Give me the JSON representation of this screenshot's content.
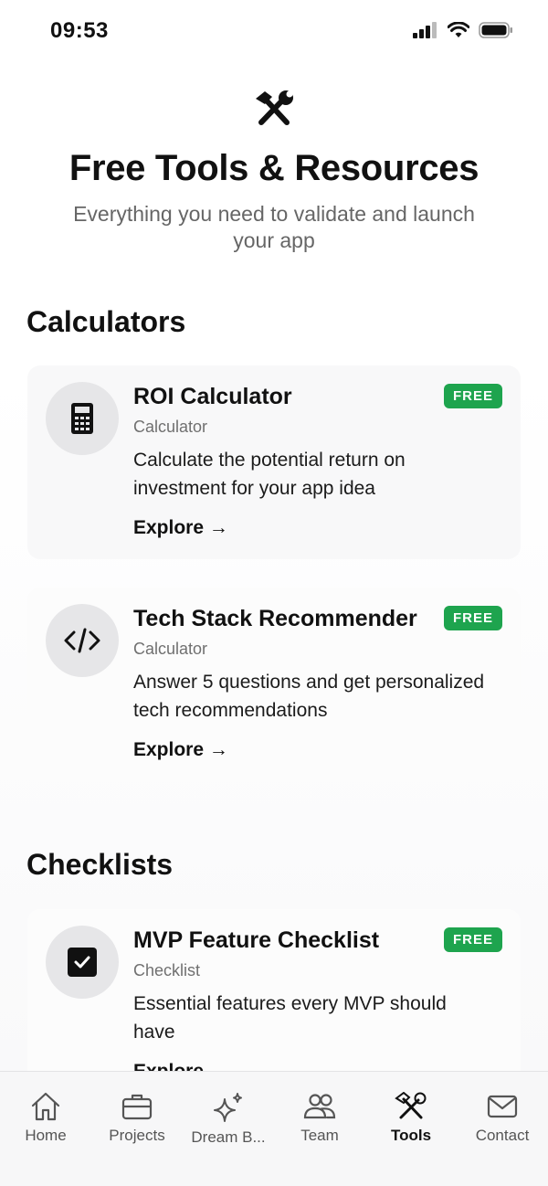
{
  "status_bar": {
    "time": "09:53"
  },
  "hero": {
    "icon": "tools-icon",
    "title": "Free Tools & Resources",
    "subtitle": "Everything you need to validate and launch your app"
  },
  "sections": {
    "calculators": {
      "title": "Calculators"
    },
    "checklists": {
      "title": "Checklists"
    }
  },
  "cards": [
    {
      "icon": "calculator-icon",
      "title": "ROI Calculator",
      "badge": "FREE",
      "type": "Calculator",
      "description": "Calculate the potential return on investment for your app idea",
      "link": "Explore →"
    },
    {
      "icon": "code-icon",
      "title": "Tech Stack Recommender",
      "badge": "FREE",
      "type": "Calculator",
      "description": "Answer 5 questions and get personalized tech recommendations",
      "link": "Explore →"
    },
    {
      "icon": "checkbox-icon",
      "title": "MVP Feature Checklist",
      "badge": "FREE",
      "type": "Checklist",
      "description": "Essential features every MVP should have",
      "link": "Explore →"
    }
  ],
  "tab_bar": {
    "active": "Tools",
    "tabs": [
      {
        "label": "Home",
        "icon": "home-icon"
      },
      {
        "label": "Projects",
        "icon": "briefcase-icon"
      },
      {
        "label": "Dream B...",
        "icon": "sparkles-icon"
      },
      {
        "label": "Team",
        "icon": "people-icon"
      },
      {
        "label": "Tools",
        "icon": "tools-icon"
      },
      {
        "label": "Contact",
        "icon": "mail-icon"
      }
    ]
  },
  "colors": {
    "badge": "#1ea44e",
    "text": "#111111",
    "muted": "#707070",
    "icon_circle": "#e6e6e8"
  }
}
